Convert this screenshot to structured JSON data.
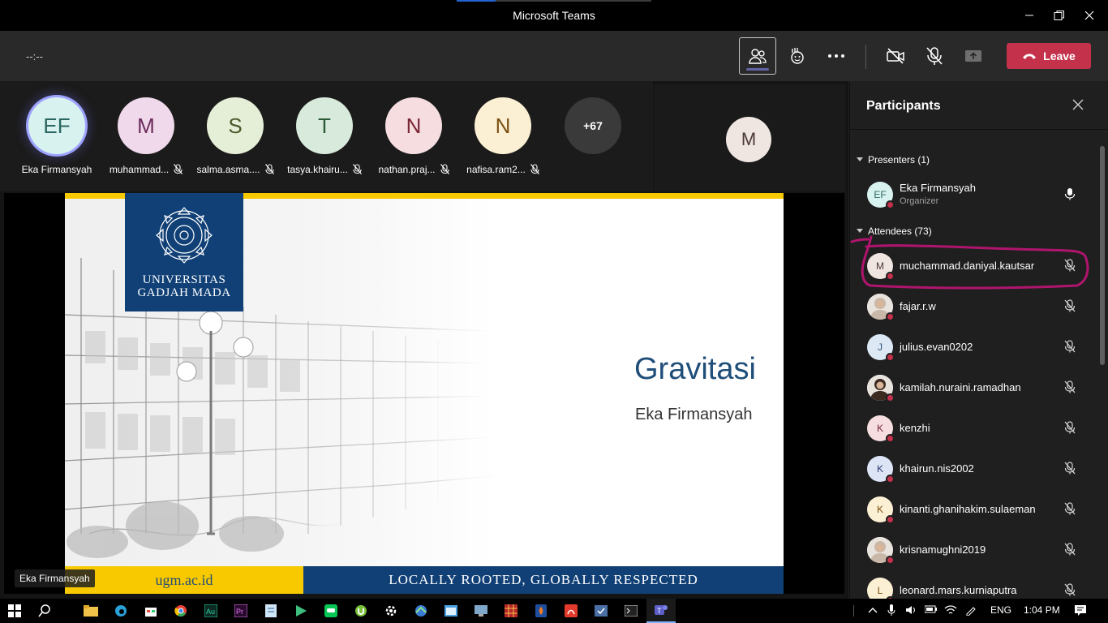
{
  "window": {
    "title": "Microsoft Teams"
  },
  "toolbar": {
    "timer": "--:--",
    "leave_label": "Leave"
  },
  "participants_strip": [
    {
      "initials": "EF",
      "name": "Eka Firmansyah",
      "bg": "#d7f2ef",
      "fg": "#2b6762",
      "ring": true,
      "muted": false
    },
    {
      "initials": "M",
      "name": "muhammad...",
      "bg": "#f0d9ea",
      "fg": "#6b2a5c",
      "ring": false,
      "muted": true
    },
    {
      "initials": "S",
      "name": "salma.asma....",
      "bg": "#e5eed7",
      "fg": "#4b5a2b",
      "ring": false,
      "muted": true
    },
    {
      "initials": "T",
      "name": "tasya.khairu...",
      "bg": "#d8eadb",
      "fg": "#2c5b38",
      "ring": false,
      "muted": true
    },
    {
      "initials": "N",
      "name": "nathan.praj...",
      "bg": "#f5dde0",
      "fg": "#7a2635",
      "ring": false,
      "muted": true
    },
    {
      "initials": "N",
      "name": "nafisa.ram2...",
      "bg": "#fcf0d4",
      "fg": "#7a5012",
      "ring": false,
      "muted": true
    }
  ],
  "more_count": "+67",
  "self_view": {
    "initials": "M"
  },
  "slide": {
    "university_line1": "UNIVERSITAS",
    "university_line2": "GADJAH MADA",
    "title": "Gravitasi",
    "subtitle": "Eka Firmansyah",
    "footer_url": "ugm.ac.id",
    "footer_tagline": "LOCALLY ROOTED, GLOBALLY RESPECTED"
  },
  "presenter_tag": "Eka Firmansyah",
  "panel": {
    "title": "Participants",
    "presenters_label": "Presenters (1)",
    "attendees_label": "Attendees (73)",
    "presenters": [
      {
        "initials": "EF",
        "name": "Eka Firmansyah",
        "role": "Organizer",
        "bg": "#d7f2ef",
        "fg": "#2b6762"
      }
    ],
    "attendees": [
      {
        "initials": "M",
        "name": "muchammad.daniyal.kautsar",
        "bg": "#efe5e1",
        "fg": "#4b3a36"
      },
      {
        "initials": "",
        "name": "fajar.r.w",
        "bg": "#dadada",
        "fg": "#333",
        "photo": true
      },
      {
        "initials": "J",
        "name": "julius.evan0202",
        "bg": "#dce9f5",
        "fg": "#2c4f74"
      },
      {
        "initials": "",
        "name": "kamilah.nuraini.ramadhan",
        "bg": "#e8d7cf",
        "fg": "#333",
        "photo": true
      },
      {
        "initials": "K",
        "name": "kenzhi",
        "bg": "#f5dde0",
        "fg": "#7a2635"
      },
      {
        "initials": "K",
        "name": "khairun.nis2002",
        "bg": "#dce4f5",
        "fg": "#2c3f74"
      },
      {
        "initials": "K",
        "name": "kinanti.ghanihakim.sulaeman",
        "bg": "#fcf0d4",
        "fg": "#7a5012"
      },
      {
        "initials": "",
        "name": "krisnamughni2019",
        "bg": "#c9c2b2",
        "fg": "#333",
        "photo": true
      },
      {
        "initials": "L",
        "name": "leonard.mars.kurniaputra",
        "bg": "#fcf0d4",
        "fg": "#7a5012"
      }
    ]
  },
  "tray": {
    "language": "ENG",
    "time": "1:04 PM"
  }
}
